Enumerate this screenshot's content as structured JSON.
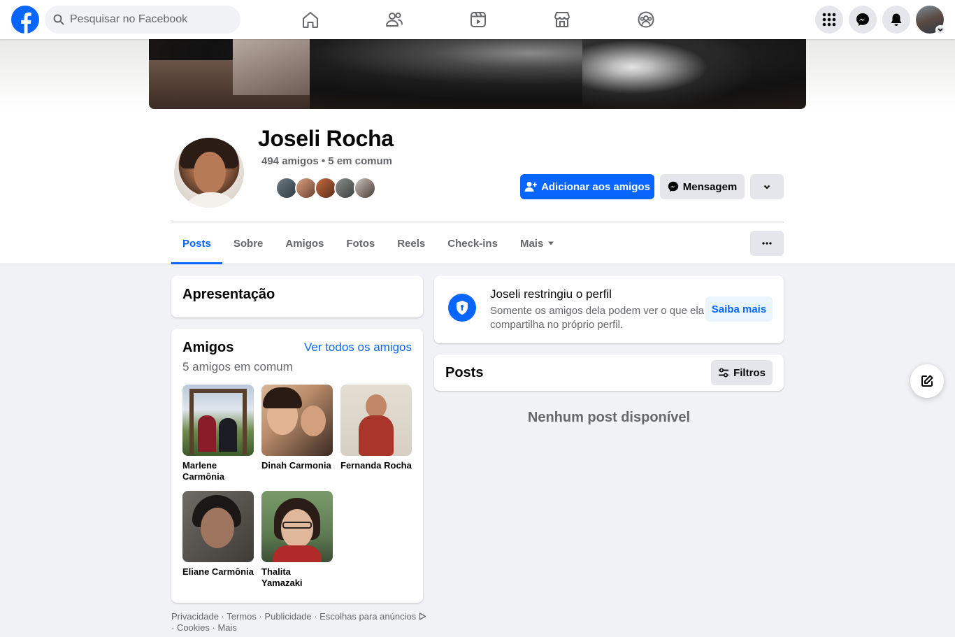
{
  "search": {
    "placeholder": "Pesquisar no Facebook"
  },
  "nav": {
    "icons": [
      "home-icon",
      "friends-icon",
      "video-icon",
      "marketplace-icon",
      "groups-icon"
    ],
    "right": [
      "menu-icon",
      "messenger-icon",
      "notifications-icon",
      "account-avatar"
    ]
  },
  "profile": {
    "name": "Joseli Rocha",
    "friends_summary": "494 amigos • 5 em comum"
  },
  "actions": {
    "add_friend": "Adicionar aos amigos",
    "message": "Mensagem"
  },
  "tabs": [
    {
      "label": "Posts",
      "active": true
    },
    {
      "label": "Sobre"
    },
    {
      "label": "Amigos"
    },
    {
      "label": "Fotos"
    },
    {
      "label": "Reels"
    },
    {
      "label": "Check-ins"
    },
    {
      "label": "Mais"
    }
  ],
  "intro": {
    "title": "Apresentação"
  },
  "friends": {
    "title": "Amigos",
    "see_all": "Ver todos os amigos",
    "mutual": "5 amigos em comum",
    "list": [
      {
        "name": "Marlene Carmônia"
      },
      {
        "name": "Dinah Carmonia"
      },
      {
        "name": "Fernanda Rocha"
      },
      {
        "name": "Eliane Carmônia"
      },
      {
        "name": "Thalita Yamazaki"
      }
    ]
  },
  "restricted": {
    "title": "Joseli restringiu o perfil",
    "text": "Somente os amigos dela podem ver o que ela compartilha no próprio perfil.",
    "learn_more": "Saiba mais"
  },
  "posts": {
    "title": "Posts",
    "filters": "Filtros",
    "empty": "Nenhum post disponível"
  },
  "footer": {
    "line1": "Privacidade · Termos · Publicidade · Escolhas para anúncios",
    "line2": "· Cookies · Mais"
  },
  "colors": {
    "brand_blue": "#0866ff",
    "background": "#f0f2f5",
    "secondary_text": "#65676b"
  }
}
